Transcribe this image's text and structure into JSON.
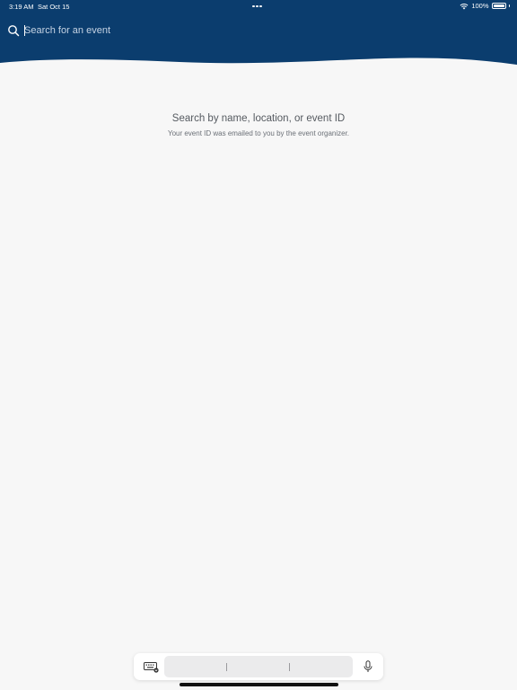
{
  "status_bar": {
    "time": "3:19 AM",
    "date": "Sat Oct 15",
    "battery": "100%"
  },
  "search": {
    "placeholder": "Search for an event",
    "value": ""
  },
  "empty_state": {
    "title": "Search by name, location, or event ID",
    "subtitle": "Your event ID was emailed to you by the event organizer."
  },
  "icons": {
    "search": "search-icon",
    "wifi": "wifi-icon",
    "battery": "battery-icon",
    "keyboard": "keyboard-icon",
    "microphone": "microphone-icon",
    "multitasking": "multitasking-dots-icon"
  },
  "colors": {
    "header_background": "#0b3d6e",
    "page_background": "#f7f7f7"
  }
}
